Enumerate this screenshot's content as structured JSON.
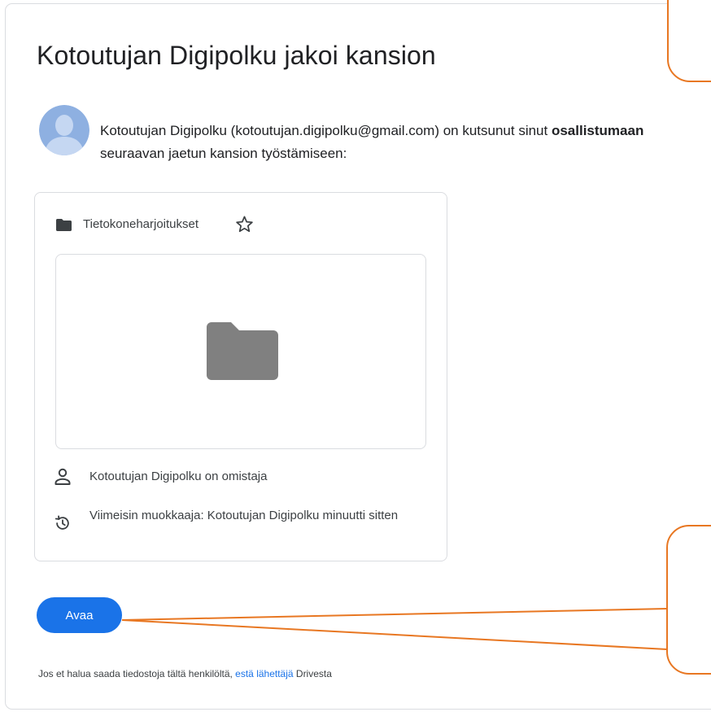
{
  "email": {
    "title": "Kotoutujan Digipolku jakoi kansion",
    "message_before": "Kotoutujan Digipolku (kotoutujan.digipolku@gmail.com) on kutsunut sinut ",
    "message_bold": "osallistumaan",
    "message_after": " seuraavan jaetun kansion työstämiseen:"
  },
  "folder_card": {
    "folder_name": "Tietokoneharjoitukset",
    "owner_text": "Kotoutujan Digipolku on omistaja",
    "last_modified_text": "Viimeisin muokkaaja: Kotoutujan Digipolku minuutti sitten"
  },
  "actions": {
    "open_label": "Avaa"
  },
  "footer": {
    "text_before": "Jos et halua saada tiedostoja tältä henkilöltä, ",
    "link_label": "estä lähettäjä",
    "text_after": " Drivesta"
  },
  "colors": {
    "accent": "#1a73e8",
    "callout": "#e87722",
    "folder_icon": "#808080",
    "avatar_bg": "#8eb0e1"
  },
  "icons": {
    "avatar": "person-silhouette-icon",
    "folder_small": "folder-icon",
    "star": "star-outline-icon",
    "folder_preview": "folder-icon",
    "owner": "person-outline-icon",
    "history": "history-icon"
  }
}
